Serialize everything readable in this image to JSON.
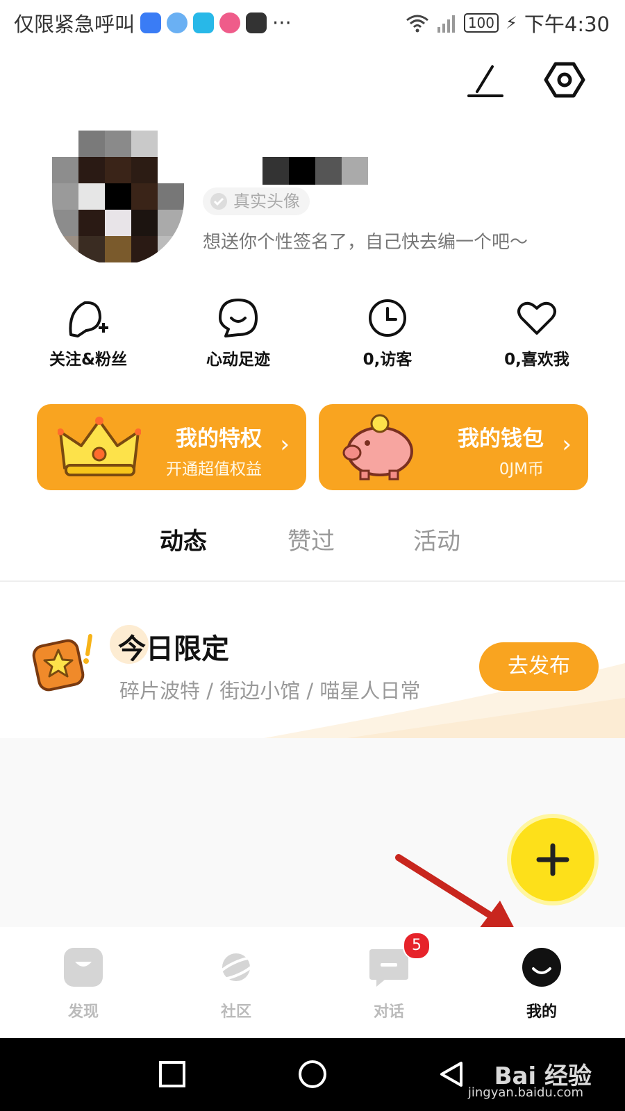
{
  "status_bar": {
    "carrier_text": "仅限紧急呼叫",
    "more": "···",
    "battery": "100",
    "time": "下午4:30"
  },
  "header": {
    "edit_icon": "edit-icon",
    "settings_icon": "settings-hex-icon"
  },
  "profile": {
    "real_avatar_tag": "真实头像",
    "signature": "想送你个性签名了，自己快去编一个吧～"
  },
  "stats": [
    {
      "label": "关注&粉丝",
      "icon": "add-user-icon"
    },
    {
      "label": "心动足迹",
      "icon": "smile-bubble-icon"
    },
    {
      "label": "0,访客",
      "icon": "clock-icon"
    },
    {
      "label": "0,喜欢我",
      "icon": "heart-icon"
    }
  ],
  "cards": {
    "privilege": {
      "title": "我的特权",
      "subtitle": "开通超值权益",
      "arrow": "›"
    },
    "wallet": {
      "title": "我的钱包",
      "subtitle": "0JM币",
      "arrow": "›"
    }
  },
  "tabs": [
    {
      "label": "动态",
      "active": true
    },
    {
      "label": "赞过",
      "active": false
    },
    {
      "label": "活动",
      "active": false
    }
  ],
  "today": {
    "title": "今日限定",
    "subtitle": "碎片波特 / 街边小馆 / 喵星人日常",
    "button": "去发布"
  },
  "bottom_nav": [
    {
      "label": "发现",
      "active": false
    },
    {
      "label": "社区",
      "active": false
    },
    {
      "label": "对话",
      "active": false,
      "badge": "5"
    },
    {
      "label": "我的",
      "active": true
    }
  ],
  "watermark": {
    "brand": "Bai 经验",
    "url": "jingyan.baidu.com"
  },
  "colors": {
    "accent": "#f9a420",
    "fab": "#fde01a",
    "badge": "#e6232a",
    "arrow": "#c8261e"
  }
}
